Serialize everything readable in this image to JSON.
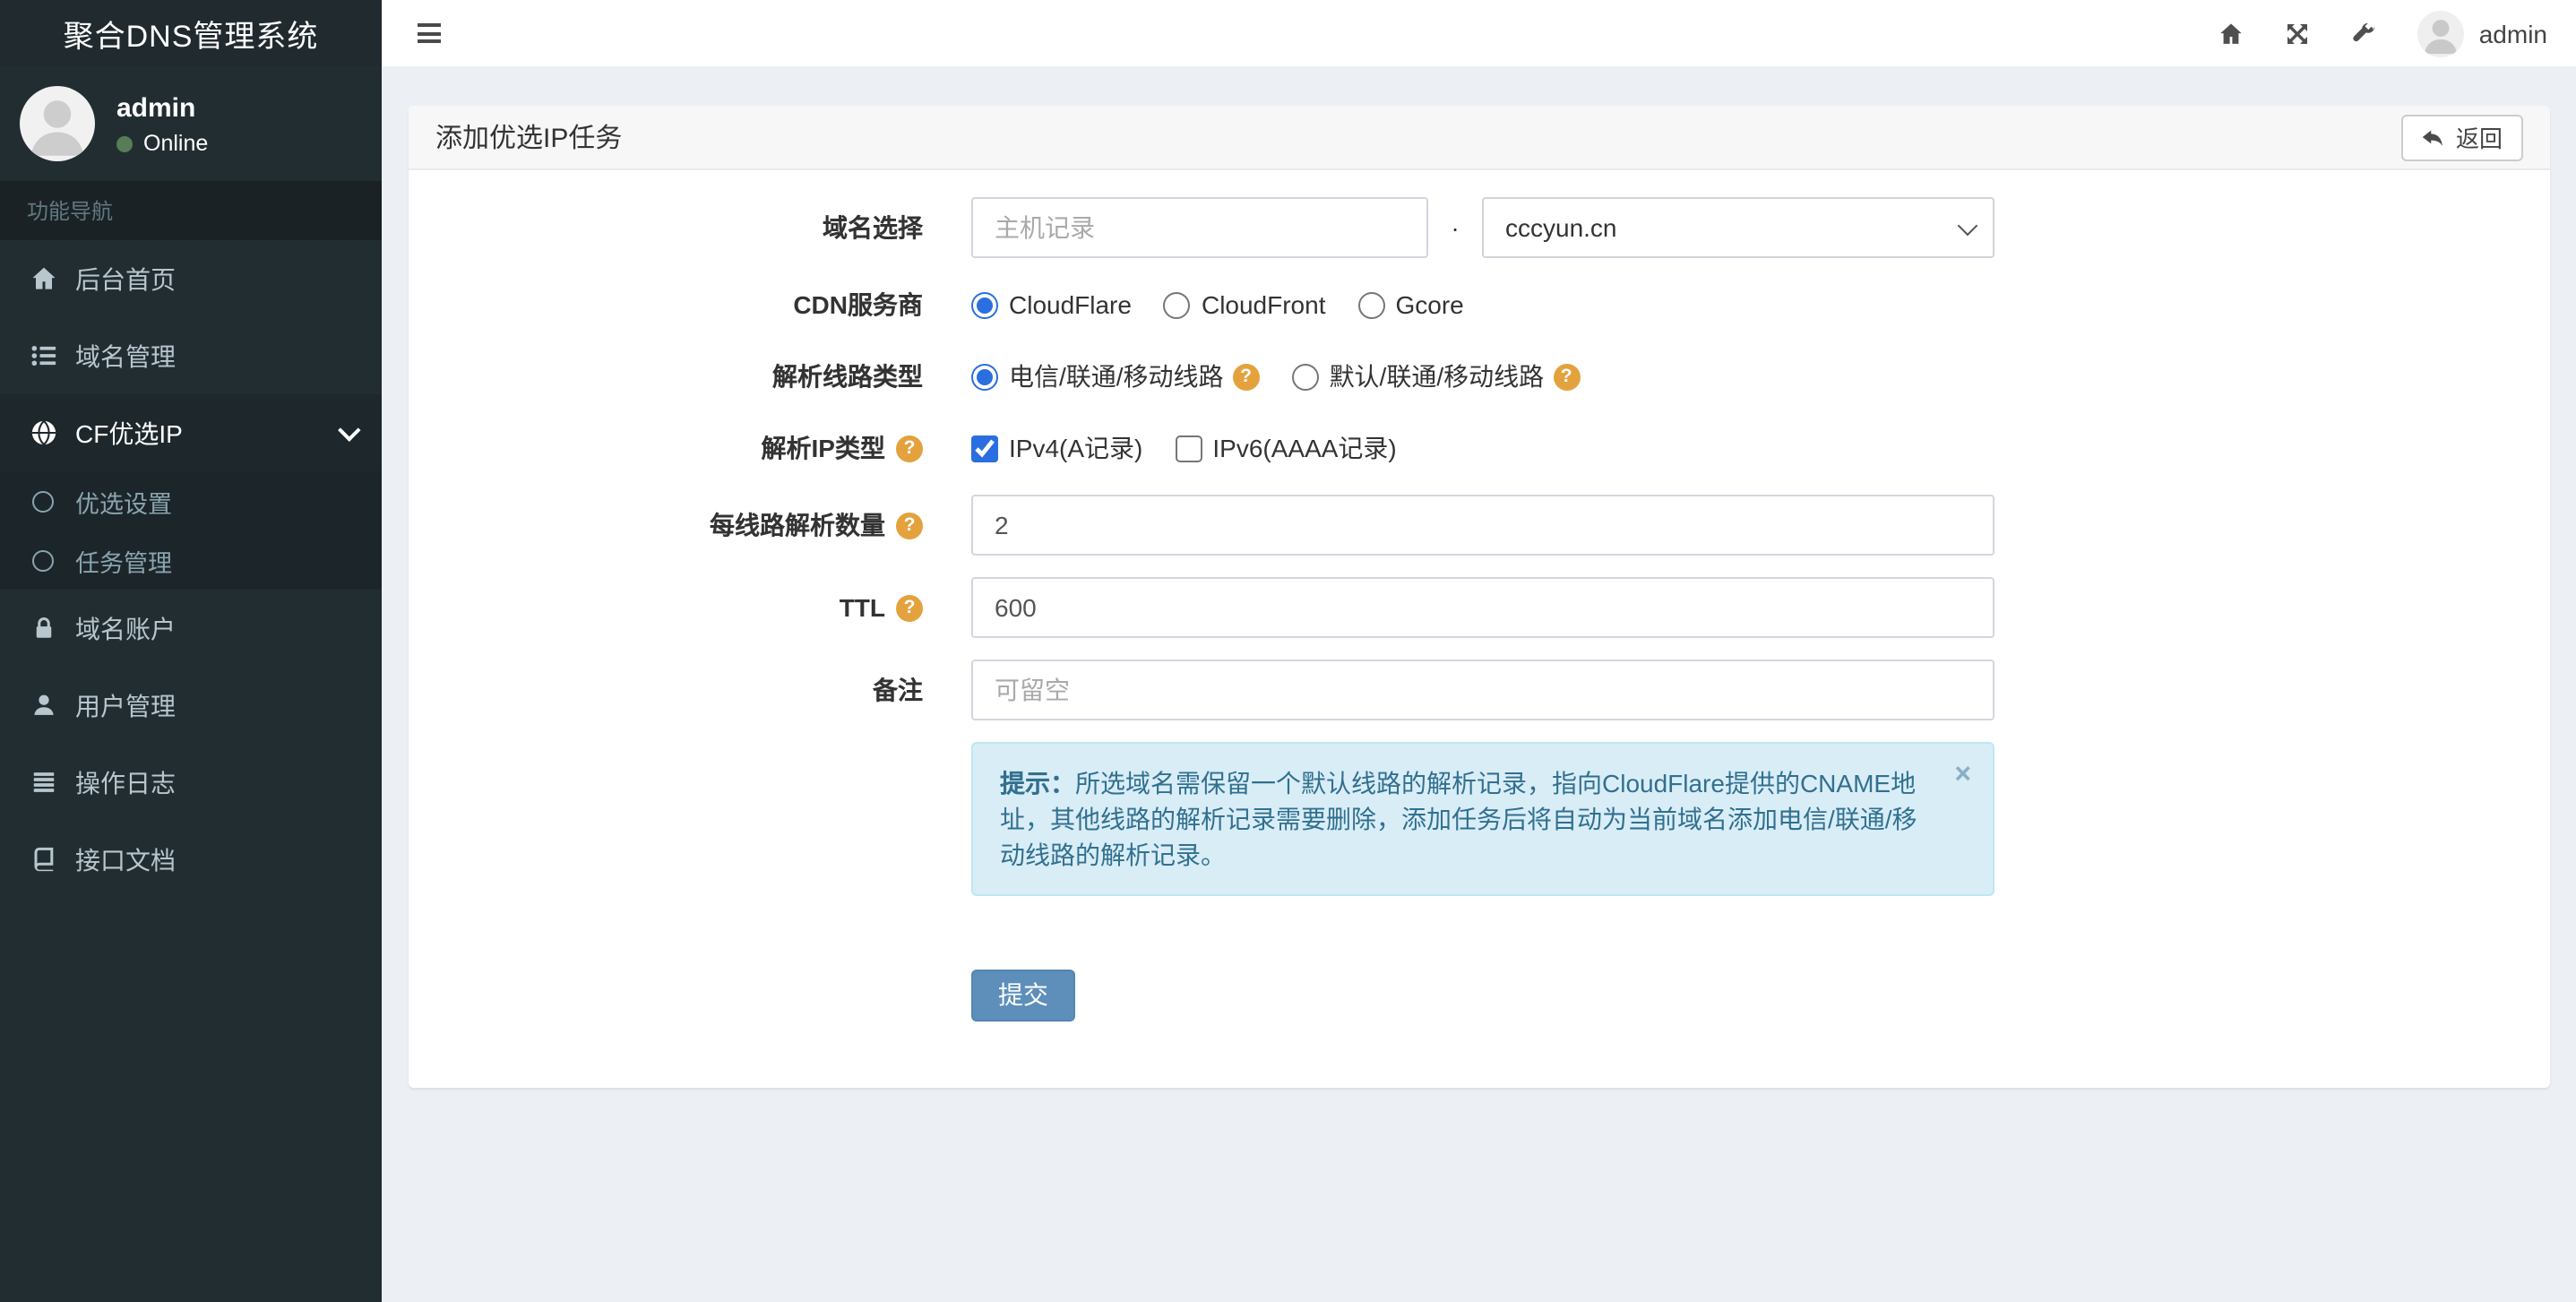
{
  "app_title": "聚合DNS管理系统",
  "topbar": {
    "user_label": "admin"
  },
  "sidebar": {
    "user": {
      "name": "admin",
      "status": "Online"
    },
    "nav_header": "功能导航",
    "menu": [
      {
        "label": "后台首页",
        "icon": "home-icon"
      },
      {
        "label": "域名管理",
        "icon": "list-ul-icon"
      },
      {
        "label": "CF优选IP",
        "icon": "globe-icon",
        "expanded": true,
        "children": [
          {
            "label": "优选设置"
          },
          {
            "label": "任务管理"
          }
        ]
      },
      {
        "label": "域名账户",
        "icon": "lock-icon"
      },
      {
        "label": "用户管理",
        "icon": "user-icon"
      },
      {
        "label": "操作日志",
        "icon": "log-list-icon"
      },
      {
        "label": "接口文档",
        "icon": "book-icon"
      }
    ]
  },
  "panel": {
    "title": "添加优选IP任务",
    "back_button": "返回",
    "form": {
      "domain": {
        "label": "域名选择",
        "host_placeholder": "主机记录",
        "separator": "·",
        "selected_domain": "cccyun.cn"
      },
      "cdn": {
        "label": "CDN服务商",
        "options": [
          "CloudFlare",
          "CloudFront",
          "Gcore"
        ],
        "checked": [
          "checked",
          null,
          null
        ]
      },
      "line_type": {
        "label": "解析线路类型",
        "options": [
          "电信/联通/移动线路",
          "默认/联通/移动线路"
        ],
        "checked": [
          "checked",
          null
        ]
      },
      "ip_type": {
        "label": "解析IP类型",
        "options": [
          "IPv4(A记录)",
          "IPv6(AAAA记录)"
        ],
        "checked": [
          "checked",
          null
        ]
      },
      "per_line": {
        "label": "每线路解析数量",
        "value": "2"
      },
      "ttl": {
        "label": "TTL",
        "value": "600"
      },
      "remark": {
        "label": "备注",
        "placeholder": "可留空"
      },
      "tip": {
        "prefix": "提示：",
        "text": "所选域名需保留一个默认线路的解析记录，指向CloudFlare提供的CNAME地址，其他线路的解析记录需要删除，添加任务后将自动为当前域名添加电信/联通/移动线路的解析记录。",
        "close": "×"
      },
      "submit_label": "提交"
    }
  },
  "glyphs": {
    "question": "?"
  },
  "colors": {
    "sidebar_bg": "#222d32",
    "sidebar_active_bg": "#1e282c",
    "accent_blue": "#2a6ee0",
    "submit_bg": "#5d8fba",
    "alert_bg": "#d9edf7",
    "alert_text": "#31708f",
    "question_badge": "#e3a23d",
    "online_green": "#567d57",
    "content_bg": "#ecf0f5"
  }
}
